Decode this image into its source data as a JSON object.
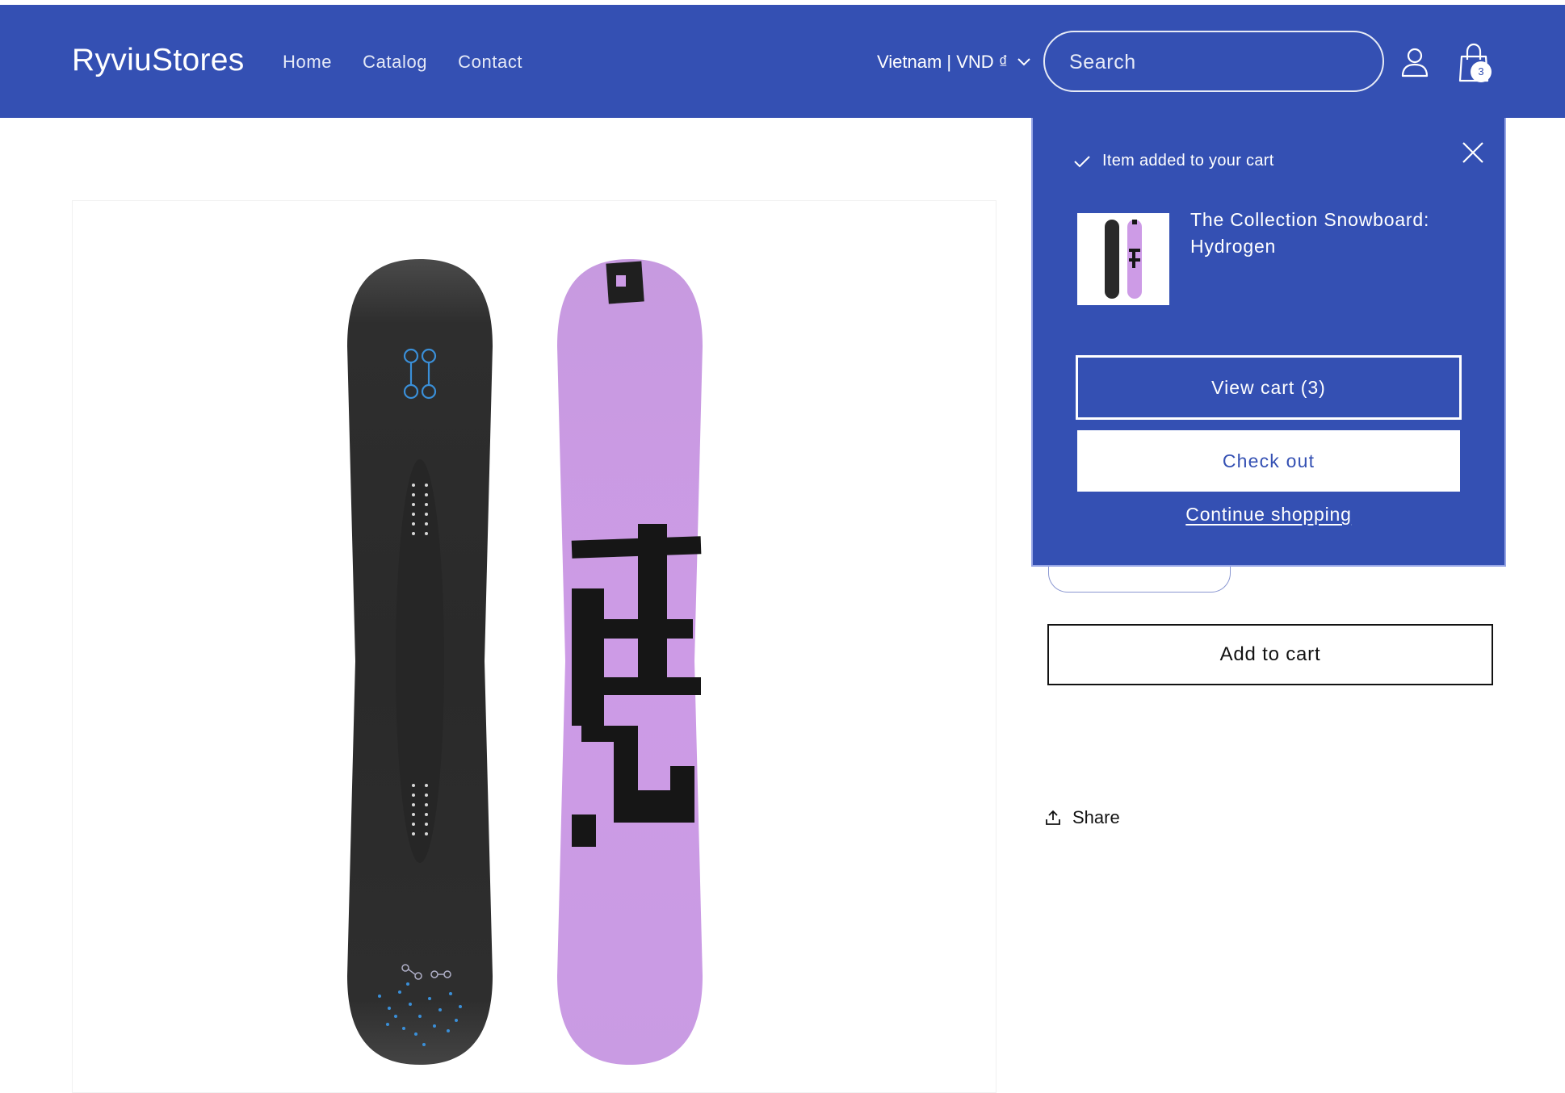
{
  "header": {
    "logo": "RyviuStores",
    "nav": [
      "Home",
      "Catalog",
      "Contact"
    ],
    "locale": "Vietnam | VND ₫",
    "search_placeholder": "Search",
    "cart_count": "3"
  },
  "product": {
    "add_to_cart_label": "Add to cart",
    "share_label": "Share"
  },
  "cart_notification": {
    "status": "Item added to your cart",
    "item_name": "The Collection Snowboard: Hydrogen",
    "view_cart_label": "View cart (3)",
    "checkout_label": "Check out",
    "continue_label": "Continue shopping"
  },
  "colors": {
    "brand": "#3450b3",
    "board_dark": "#2a2a2a",
    "board_purple": "#cd9be6"
  },
  "icons": [
    "chevron-down-icon",
    "account-icon",
    "cart-icon",
    "check-icon",
    "close-icon",
    "share-icon"
  ]
}
